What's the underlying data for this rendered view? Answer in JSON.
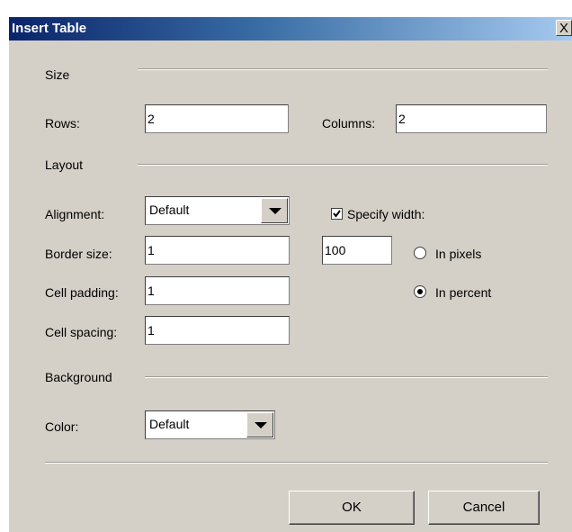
{
  "window": {
    "title": "Insert Table",
    "close_label": "X"
  },
  "size": {
    "heading": "Size",
    "rows_label": "Rows:",
    "rows_value": "2",
    "columns_label": "Columns:",
    "columns_value": "2"
  },
  "layout": {
    "heading": "Layout",
    "alignment_label": "Alignment:",
    "alignment_value": "Default",
    "specify_width_label": "Specify width:",
    "specify_width_checked": true,
    "border_label": "Border size:",
    "border_value": "1",
    "width_value": "100",
    "in_pixels_label": "In pixels",
    "in_pixels_selected": false,
    "in_percent_label": "In percent",
    "in_percent_selected": true,
    "padding_label": "Cell padding:",
    "padding_value": "1",
    "spacing_label": "Cell spacing:",
    "spacing_value": "1"
  },
  "background": {
    "heading": "Background",
    "color_label": "Color:",
    "color_value": "Default"
  },
  "buttons": {
    "ok": "OK",
    "cancel": "Cancel"
  },
  "icons": {
    "close": "close-icon",
    "dropdown": "chevron-down-icon",
    "check": "checkmark-icon",
    "radio_dot": "radio-dot-icon"
  }
}
